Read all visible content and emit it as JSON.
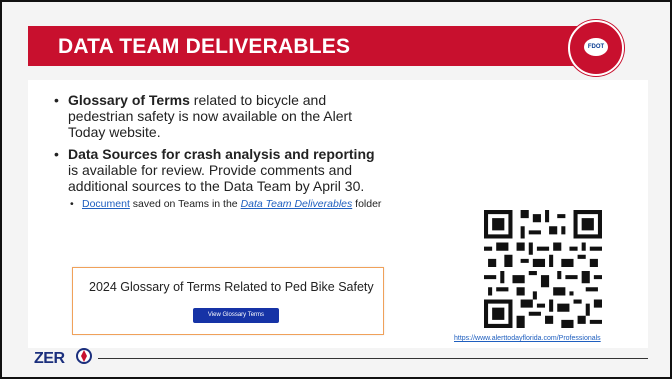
{
  "header": {
    "title": "DATA TEAM DELIVERABLES"
  },
  "logo": {
    "badge_text": "FDOT"
  },
  "bullets": [
    {
      "bold": "Glossary of Terms",
      "text": " related to bicycle and pedestrian safety is now available on the Alert Today website."
    },
    {
      "bold": "Data Sources for crash analysis and reporting",
      "text": " is available for review. Provide comments and additional sources to the Data Team by April 30.",
      "sub": {
        "link1": "Document",
        "mid": " saved on Teams in the ",
        "link2": "Data Team Deliverables",
        "end": " folder"
      }
    }
  ],
  "glossary": {
    "title": "2024 Glossary of Terms Related to Ped Bike Safety",
    "button_label": "View Glossary Terms"
  },
  "qr": {
    "url_text": "https://www.alerttodayflorida.com/Professionals"
  },
  "footer": {
    "logo_text": "ZER"
  }
}
